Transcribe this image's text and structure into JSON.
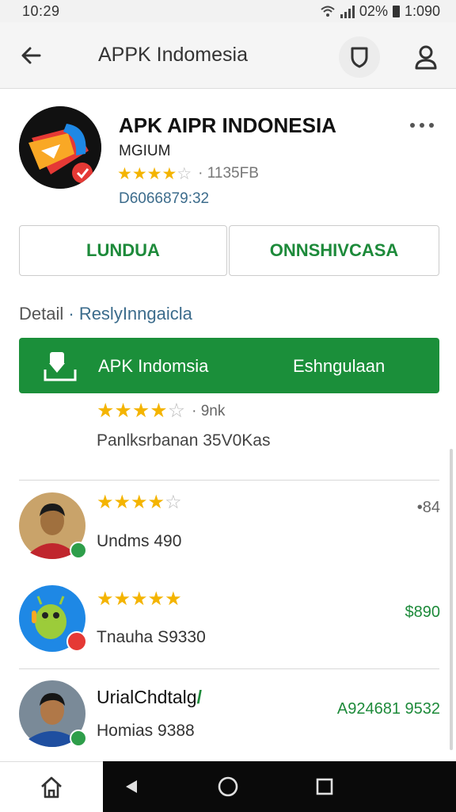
{
  "status_bar": {
    "time": "10:29",
    "battery": "02%",
    "clock": "1:090"
  },
  "toolbar": {
    "title": "APPK Indomesia"
  },
  "app": {
    "title": "APK AIPR INDONESIA",
    "developer": "MGIUM",
    "rating_stars": 3.5,
    "size": "· 1135FB",
    "downloads": "D6066879:32"
  },
  "buttons": {
    "left_label": "LUNDUA",
    "right_label": "ONNSHIVCASA"
  },
  "section": {
    "heading_part1": "Detail",
    "heading_part2": "· ReslyInngaicla"
  },
  "install_bar": {
    "label": "APK Indomsia",
    "action": "Eshngulaan"
  },
  "summary": {
    "stars": 4,
    "count": "· 9nk",
    "text": "Panlksrbanan   35V0Kas"
  },
  "reviews": [
    {
      "stars": 3.5,
      "name": "Undms 490",
      "value": "•84",
      "value_color": "#666666"
    },
    {
      "stars": 4.5,
      "name": "Tnauha S9330",
      "value": "$890",
      "value_color": "#1d8a3a"
    },
    {
      "stars": 0,
      "name": "UrialChdtalg",
      "name_mark": "/",
      "subtitle": "Homias 9388",
      "value": "A924681 9532",
      "value_color": "#1d8a3a"
    }
  ],
  "colors": {
    "accent_green": "#1b8f3a",
    "star_gold": "#f4b400",
    "link_blue": "#3c6c8c"
  },
  "icons": [
    "back-arrow-icon",
    "shield-icon",
    "account-icon",
    "overflow-menu-icon",
    "download-icon",
    "home-icon",
    "nav-back-icon",
    "nav-home-circle-icon",
    "nav-recents-icon"
  ]
}
